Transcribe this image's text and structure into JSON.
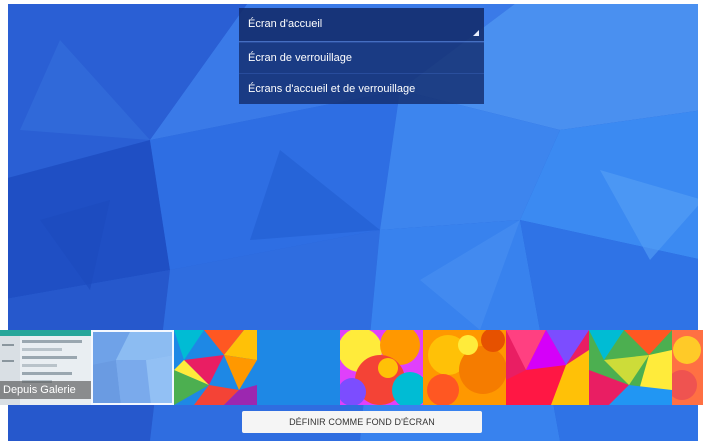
{
  "dropdown": {
    "options": [
      {
        "label": "Écran d'accueil",
        "selected": true
      },
      {
        "label": "Écran de verrouillage",
        "selected": false
      },
      {
        "label": "Écrans d'accueil et de verrouillage",
        "selected": false
      }
    ]
  },
  "thumbnails": [
    {
      "name": "gallery",
      "label": "Depuis Galerie"
    },
    {
      "name": "current-blue-polygon",
      "selected": true
    },
    {
      "name": "colorful-polygon-1"
    },
    {
      "name": "solid-blue"
    },
    {
      "name": "colorful-abstract-1"
    },
    {
      "name": "orange-abstract"
    },
    {
      "name": "colorful-polygon-2"
    },
    {
      "name": "colorful-polygon-3"
    },
    {
      "name": "colorful-partial"
    }
  ],
  "set_button": {
    "label": "DÉFINIR COMME FOND D'ÉCRAN"
  },
  "colors": {
    "wallpaper_base": "#2f6fe0",
    "dropdown_bg": "#142d6e",
    "button_bg": "#f5f5f5"
  }
}
